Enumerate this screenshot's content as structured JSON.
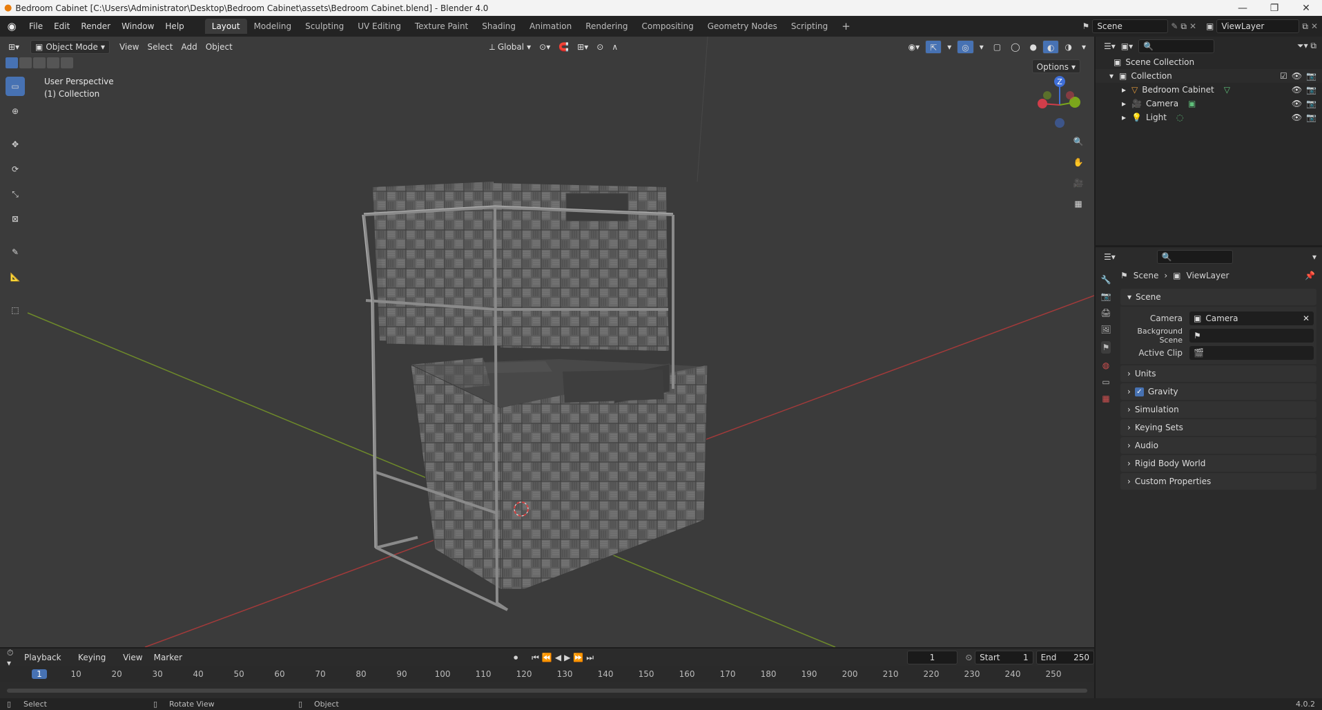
{
  "window": {
    "title": "Bedroom Cabinet [C:\\Users\\Administrator\\Desktop\\Bedroom Cabinet\\assets\\Bedroom Cabinet.blend] - Blender 4.0"
  },
  "menus": [
    "File",
    "Edit",
    "Render",
    "Window",
    "Help"
  ],
  "workspaces": [
    "Layout",
    "Modeling",
    "Sculpting",
    "UV Editing",
    "Texture Paint",
    "Shading",
    "Animation",
    "Rendering",
    "Compositing",
    "Geometry Nodes",
    "Scripting"
  ],
  "scene_selector": {
    "value": "Scene"
  },
  "viewlayer_selector": {
    "value": "ViewLayer"
  },
  "viewport": {
    "mode": "Object Mode",
    "menus": [
      "View",
      "Select",
      "Add",
      "Object"
    ],
    "orientation": "Global",
    "options_label": "Options",
    "overlay_title": "User Perspective",
    "overlay_subtitle": "(1) Collection",
    "gizmo_z": "Z"
  },
  "outliner": {
    "root": "Scene Collection",
    "collection": "Collection",
    "items": [
      {
        "name": "Bedroom Cabinet"
      },
      {
        "name": "Camera"
      },
      {
        "name": "Light"
      }
    ]
  },
  "properties": {
    "breadcrumb_scene": "Scene",
    "breadcrumb_layer": "ViewLayer",
    "section_scene": "Scene",
    "camera_label": "Camera",
    "camera_value": "Camera",
    "bg_scene_label": "Background Scene",
    "active_clip_label": "Active Clip",
    "sections": [
      "Units",
      "Gravity",
      "Simulation",
      "Keying Sets",
      "Audio",
      "Rigid Body World",
      "Custom Properties"
    ],
    "gravity_checked": true
  },
  "timeline": {
    "menus": [
      "Playback",
      "Keying",
      "View",
      "Marker"
    ],
    "current_frame": "1",
    "start_label": "Start",
    "start_value": "1",
    "end_label": "End",
    "end_value": "250",
    "ticks": [
      "1",
      "10",
      "20",
      "30",
      "40",
      "50",
      "60",
      "70",
      "80",
      "90",
      "100",
      "110",
      "120",
      "130",
      "140",
      "150",
      "160",
      "170",
      "180",
      "190",
      "200",
      "210",
      "220",
      "230",
      "240",
      "250"
    ]
  },
  "statusbar": {
    "select": "Select",
    "rotate": "Rotate View",
    "object": "Object",
    "version": "4.0.2"
  },
  "colors": {
    "accent": "#4772b3",
    "axis_x": "#a33a3a",
    "axis_y": "#6e8a2a",
    "bg_viewport": "#3b3b3b"
  }
}
